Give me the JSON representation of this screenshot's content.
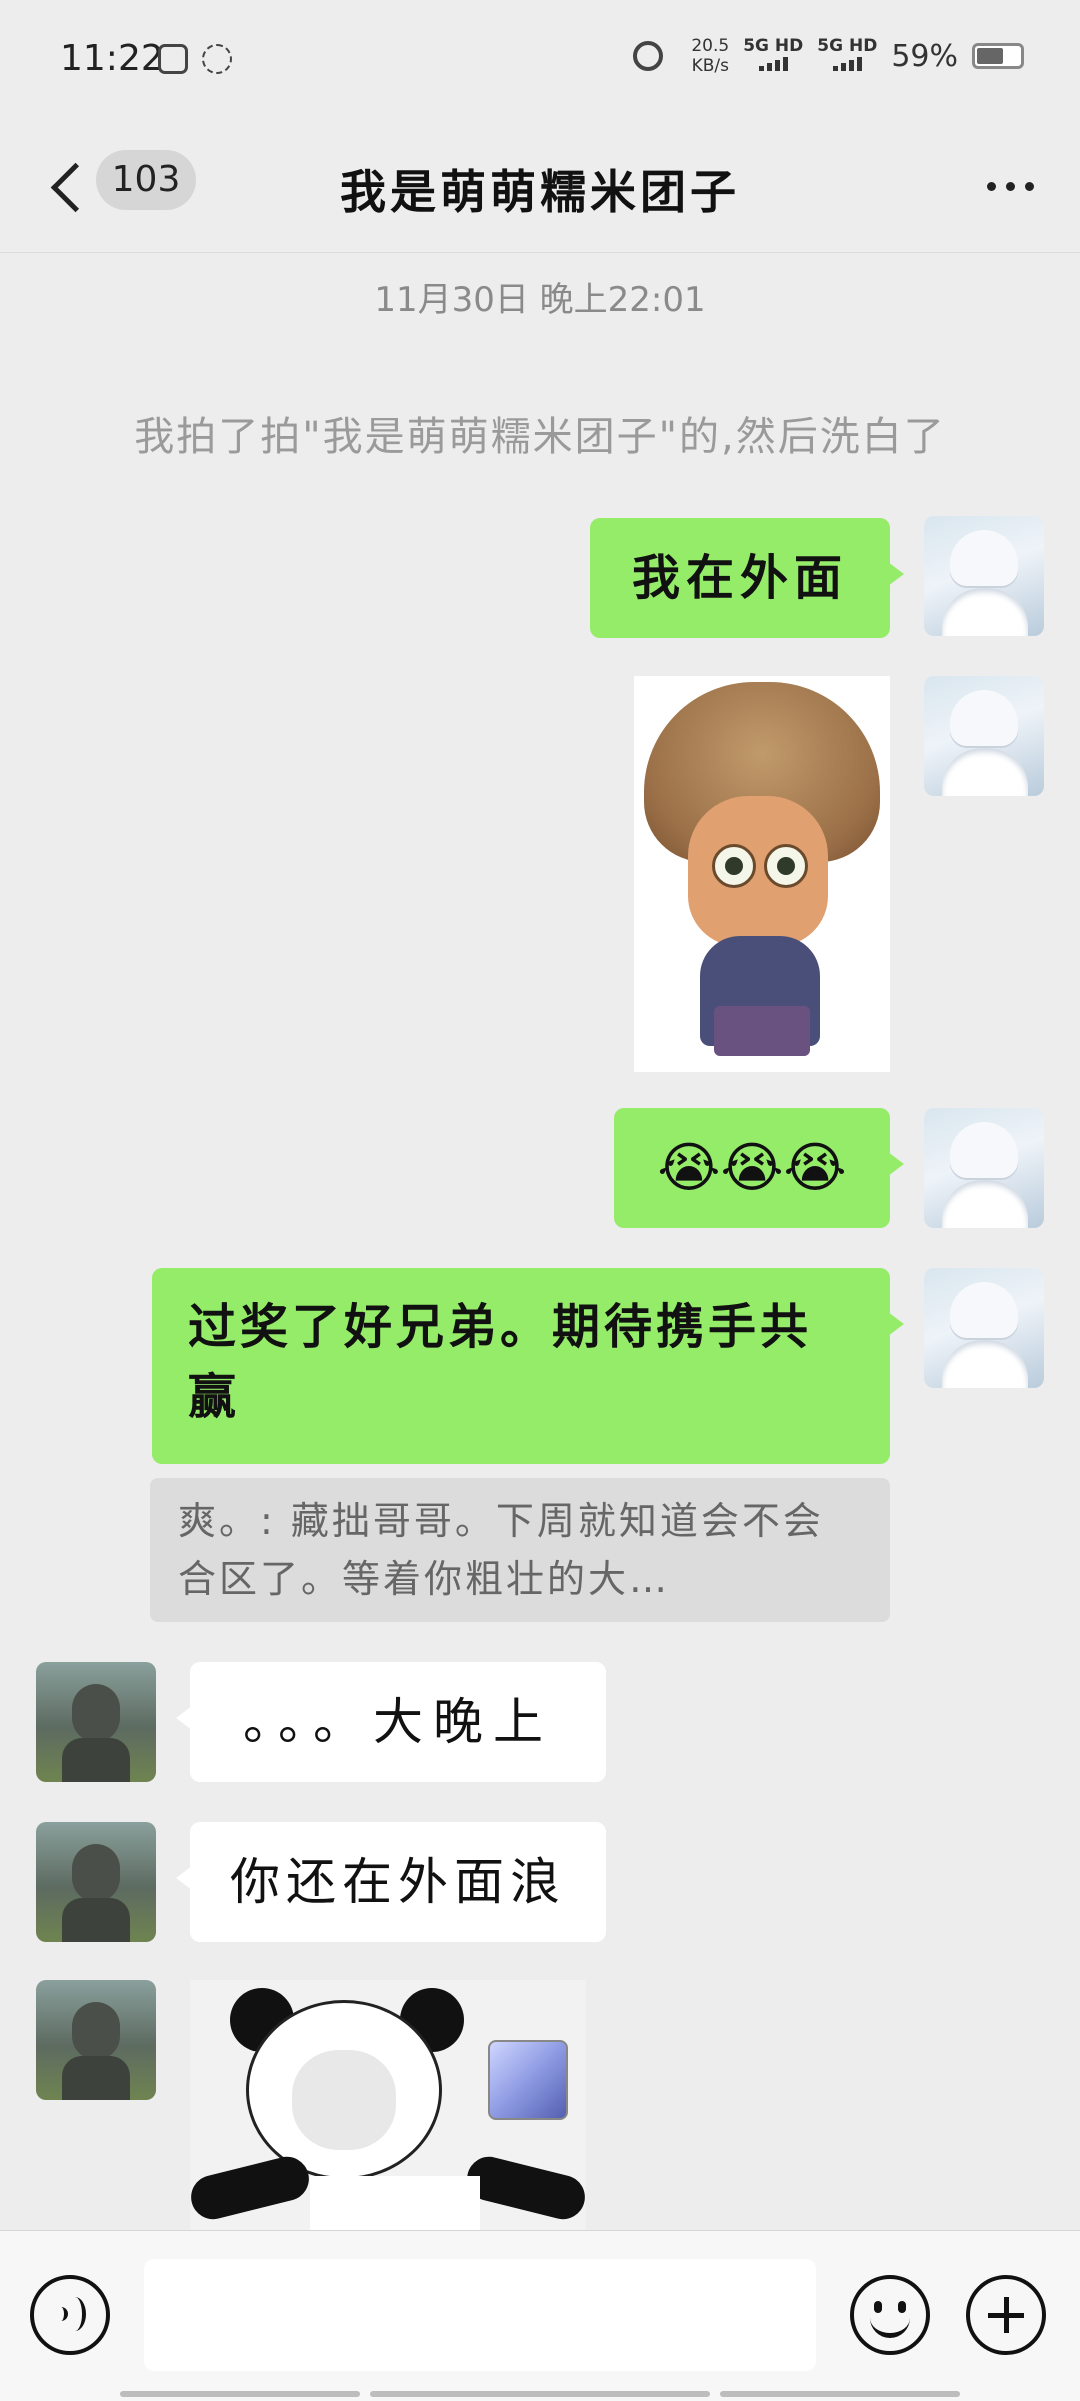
{
  "status_bar": {
    "time": "11:22",
    "speed_value": "20.5",
    "speed_unit": "KB/s",
    "network_1": "5G HD",
    "network_2": "5G HD",
    "battery_percent": "59%",
    "battery_level": 0.59,
    "icons": [
      "screen-mirror-icon",
      "nfc-icon",
      "alarm-icon",
      "signal-icon",
      "battery-icon"
    ]
  },
  "header": {
    "unread_count": "103",
    "title": "我是萌萌糯米团子",
    "icons": [
      "back-chevron-icon",
      "more-dots-icon"
    ]
  },
  "chat": {
    "timestamp": "11月30日 晚上22:01",
    "system_message": "我拍了拍\"我是萌萌糯米团子\"的,然后洗白了",
    "messages": [
      {
        "side": "out",
        "type": "text",
        "text": "我在外面"
      },
      {
        "side": "out",
        "type": "sticker",
        "sticker": "bald-qiang-sticker"
      },
      {
        "side": "out",
        "type": "text",
        "text": "😭😭😭"
      },
      {
        "side": "out",
        "type": "text",
        "text": "过奖了好兄弟。期待携手共赢"
      },
      {
        "side": "in",
        "type": "text",
        "text": "。。。大晚上"
      },
      {
        "side": "in",
        "type": "text",
        "text": "你还在外面浪"
      },
      {
        "side": "in",
        "type": "sticker",
        "sticker": "panda-meme-sticker"
      }
    ],
    "quote": "爽。: 藏拙哥哥。下周就知道会不会合区了。等着你粗壮的大…"
  },
  "input_bar": {
    "input_value": "",
    "icons": [
      "voice-icon",
      "emoji-icon",
      "plus-icon"
    ]
  },
  "colors": {
    "background": "#ededed",
    "outgoing_bubble": "#95ec69",
    "incoming_bubble": "#ffffff",
    "quote_background": "#dcdcdc"
  }
}
